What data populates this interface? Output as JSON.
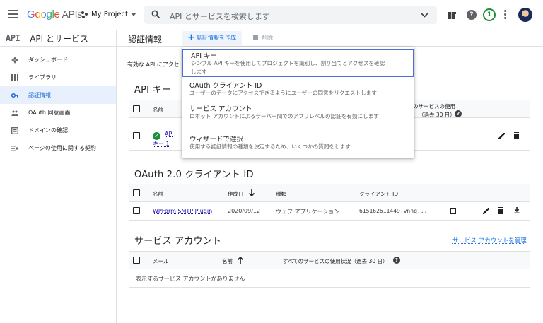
{
  "topbar": {
    "logo_google": "Google",
    "logo_apis": "APIs",
    "project": "My Project",
    "search_placeholder": "API とサービスを検索します",
    "help": "?",
    "notification_count": "1"
  },
  "sidebar": {
    "glyph": "API",
    "title": "API とサービス",
    "items": [
      {
        "label": "ダッシュボード",
        "icon": "dashboard-icon"
      },
      {
        "label": "ライブラリ",
        "icon": "library-icon"
      },
      {
        "label": "認証情報",
        "icon": "key-icon",
        "active": true
      },
      {
        "label": "OAuth 同意画面",
        "icon": "oauth-icon"
      },
      {
        "label": "ドメインの確認",
        "icon": "domain-icon"
      },
      {
        "label": "ページの使用に関する契約",
        "icon": "settings-icon"
      }
    ]
  },
  "header": {
    "title": "認証情報",
    "create_label": "認証情報を作成",
    "delete_label": "削除"
  },
  "main": {
    "notice": "有効な API にアクセ",
    "api_keys": {
      "title": "API キー",
      "columns": [
        "名前",
        "のサービスの使用",
        "（過去 30 日）"
      ],
      "row": {
        "name_line1": "API",
        "name_line2": "キー 1"
      }
    },
    "oauth": {
      "title": "OAuth 2.0 クライアント ID",
      "columns": [
        "名前",
        "作成日",
        "種類",
        "クライアント ID"
      ],
      "row": {
        "name": "WPForm SMTP Plugin",
        "date": "2020/09/12",
        "type": "ウェブ アプリケーション",
        "client_id": "615162611449-vnnq..."
      }
    },
    "service": {
      "title": "サービス アカウント",
      "manage_label": "サービス アカウントを管理",
      "columns": [
        "メール",
        "名前",
        "すべてのサービスの使用状況（過去 30 日）"
      ],
      "empty": "表示するサービス アカウントがありません"
    }
  },
  "menu": {
    "items": [
      {
        "title": "API キー",
        "desc": "シンプル API キーを使用してプロジェクトを識別し、割り当てとアクセスを確認",
        "desc2": "します"
      },
      {
        "title": "OAuth クライアント ID",
        "desc": "ユーザーのデータにアクセスできるようにユーザーの同意をリクエストします"
      },
      {
        "title": "サービス アカウント",
        "desc": "ロボット アカウントによるサーバー間でのアプリレベルの認証を有効にします"
      },
      {
        "title": "ウィザードで選択",
        "desc": "使用する認証情報の種類を決定するため、いくつかの質問をします"
      }
    ]
  },
  "colors": {
    "accent": "#1a73e8",
    "active_bg": "#e8f0fe",
    "green": "#1e8e3e"
  }
}
